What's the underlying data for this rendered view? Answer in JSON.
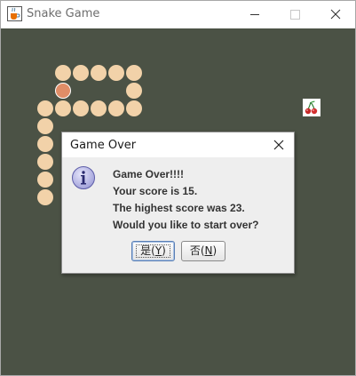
{
  "window": {
    "title": "Snake Game",
    "app_icon": "java-cup-icon",
    "controls": [
      "minimize-icon",
      "maximize-icon",
      "close-icon"
    ]
  },
  "board": {
    "background_color": "#4b5245",
    "snake_color": "#f2d2a9",
    "head_color": "#e08d67",
    "food_icon": "cherry-icon"
  },
  "dialog": {
    "title": "Game Over",
    "icon": "info-icon",
    "lines": [
      "Game Over!!!!",
      "Your score is 15.",
      "The highest score was 23.",
      "Would you like to start over?"
    ],
    "yes_button": {
      "text": "是(",
      "mnemonic": "Y",
      "suffix": ")"
    },
    "no_button": {
      "text": "否(",
      "mnemonic": "N",
      "suffix": ")"
    }
  }
}
